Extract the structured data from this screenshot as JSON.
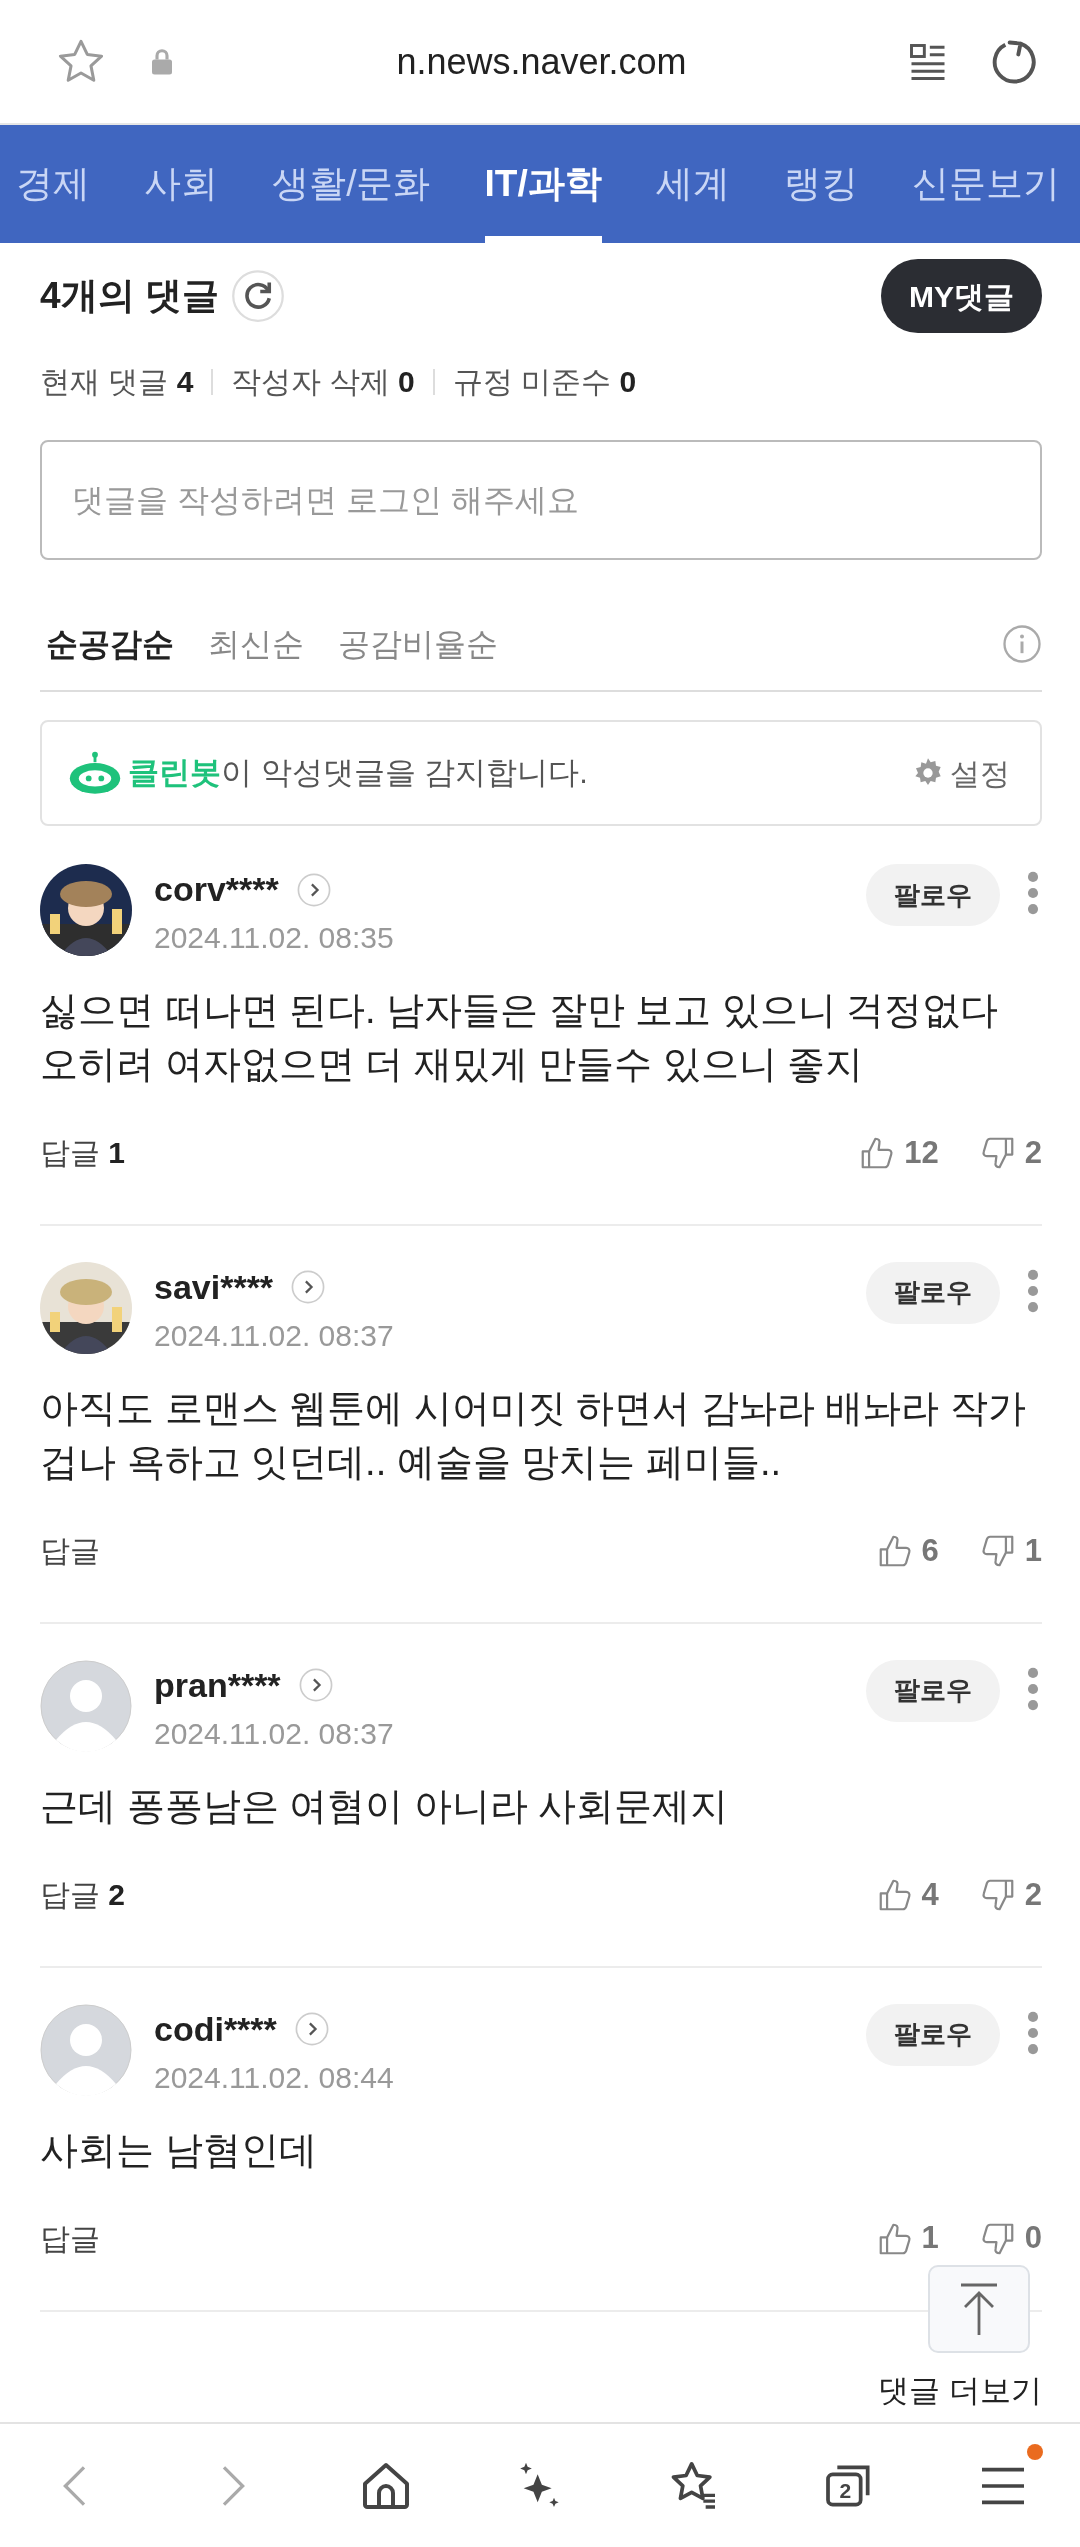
{
  "address_bar": {
    "url": "n.news.naver.com"
  },
  "nav": {
    "items": [
      {
        "label": "경제",
        "selected": false
      },
      {
        "label": "사회",
        "selected": false
      },
      {
        "label": "생활/문화",
        "selected": false
      },
      {
        "label": "IT/과학",
        "selected": true
      },
      {
        "label": "세계",
        "selected": false
      },
      {
        "label": "랭킹",
        "selected": false
      },
      {
        "label": "신문보기",
        "selected": false
      }
    ]
  },
  "comments_header": {
    "title": "4개의 댓글",
    "my_button": "MY댓글"
  },
  "stats": [
    {
      "label": "현재 댓글",
      "value": "4"
    },
    {
      "label": "작성자 삭제",
      "value": "0"
    },
    {
      "label": "규정 미준수",
      "value": "0"
    }
  ],
  "comment_input": {
    "placeholder": "댓글을 작성하려면 로그인 해주세요"
  },
  "sort_tabs": [
    {
      "label": "순공감순",
      "selected": true
    },
    {
      "label": "최신순",
      "selected": false
    },
    {
      "label": "공감비율순",
      "selected": false
    }
  ],
  "cleanbot": {
    "text": "**클린봇**이 악성댓글을 감지합니다.",
    "settings": "설정"
  },
  "comments": [
    {
      "user": "corv****",
      "date": "2024.11.02. 08:35",
      "follow": "팔로우",
      "text": "싫으면 떠나면 된다. 남자들은 잘만 보고 있으니 걱정없다 오히려 여자없으면 더 재밌게 만들수 있으니 좋지",
      "reply_label": "답글",
      "reply_count": "1",
      "likes": "12",
      "dislikes": "2"
    },
    {
      "user": "savi****",
      "date": "2024.11.02. 08:37",
      "follow": "팔로우",
      "text": "아직도 로맨스 웹툰에 시어미짓 하면서 감놔라 배놔라 작가 겁나 욕하고 잇던데.. 예술을 망치는 페미들..",
      "reply_label": "답글",
      "likes": "6",
      "dislikes": "1"
    },
    {
      "avatar": {
        "kind": "default"
      },
      "user": "pran****",
      "date": "2024.11.02. 08:37",
      "follow": "팔로우",
      "text": "근데 퐁퐁남은 여혐이 아니라 사회문제지",
      "reply_label": "답글",
      "reply_count": "2",
      "likes": "4",
      "dislikes": "2"
    },
    {
      "avatar": {
        "kind": "default"
      },
      "user": "codi****",
      "date": "2024.11.02. 08:44",
      "follow": "팔로우",
      "text": "사회는 남혐인데",
      "reply_label": "답글",
      "likes": "1",
      "dislikes": "0"
    }
  ],
  "more_link": "댓글 더보기",
  "bottom_bar": {
    "tab_count": "2",
    "menu_badge": true
  }
}
